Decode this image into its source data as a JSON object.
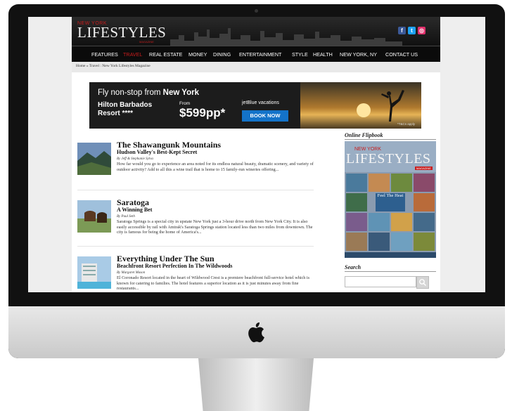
{
  "site": {
    "logo_top": "NEW YORK",
    "logo_main": "LIFESTYLES",
    "logo_tag": "MAGAZINE",
    "social": [
      {
        "icon": "facebook-icon",
        "glyph": "f",
        "color": "#3b5998"
      },
      {
        "icon": "twitter-icon",
        "glyph": "t",
        "color": "#1da1f2"
      },
      {
        "icon": "instagram-icon",
        "glyph": "◎",
        "color": "#e1306c"
      }
    ],
    "nav": [
      "FEATURES",
      "TRAVEL",
      "REAL ESTATE",
      "MONEY",
      "DINING",
      "ENTERTAINMENT",
      "STYLE",
      "HEALTH",
      "NEW YORK, NY",
      "CONTACT US"
    ],
    "nav_active": "TRAVEL",
    "breadcrumb": "Home » Travel : New York Lifestyles Magazine"
  },
  "banner": {
    "line1_prefix": "Fly non-stop from ",
    "line1_bold": "New York",
    "hotel_line1": "Hilton Barbados",
    "hotel_line2": "Resort ****",
    "from": "From",
    "price": "$599pp*",
    "brand": "jetBlue vacations",
    "cta": "BOOK NOW",
    "fine": "*T&Cs apply"
  },
  "articles": [
    {
      "title": "The Shawangunk Mountains",
      "subtitle": "Hudson Valley's Best-Kept Secret",
      "byline": "By Jeff & Stephanie Sylva",
      "excerpt": "How far would you go to experience an area noted for its endless natural beauty, dramatic scenery, and variety of outdoor activity? Add to all this a wine trail that is home to 15 family-run wineries offering..."
    },
    {
      "title": "Saratoga",
      "subtitle": "A Winning Bet",
      "byline": "By Paul Seth",
      "excerpt": "Saratoga Springs is a special city in upstate New York just a 3-hour drive north from New York City. It is also easily accessible by rail with Amtrak's Saratoga Springs station located less than two miles from downtown. The city is famous for being the home of America's..."
    },
    {
      "title": "Everything Under The Sun",
      "subtitle": "Beachfront Resort Perfection In The Wildwoods",
      "byline": "By Margaret Mason",
      "excerpt": "El Coronado Resort located in the heart of Wildwood Crest is a premiere beachfront full-service hotel which is known for catering to families. The hotel features a superior location as it is just minutes away from fine restaurants..."
    }
  ],
  "sidebar": {
    "flipbook_heading": "Online Flipbook",
    "flipbook_logo_top": "NEW YORK",
    "flipbook_logo": "LIFESTYLES",
    "flipbook_tag": "MAGAZINE",
    "flipbook_feature": "Feel The Heat",
    "search_heading": "Search",
    "search_value": ""
  }
}
